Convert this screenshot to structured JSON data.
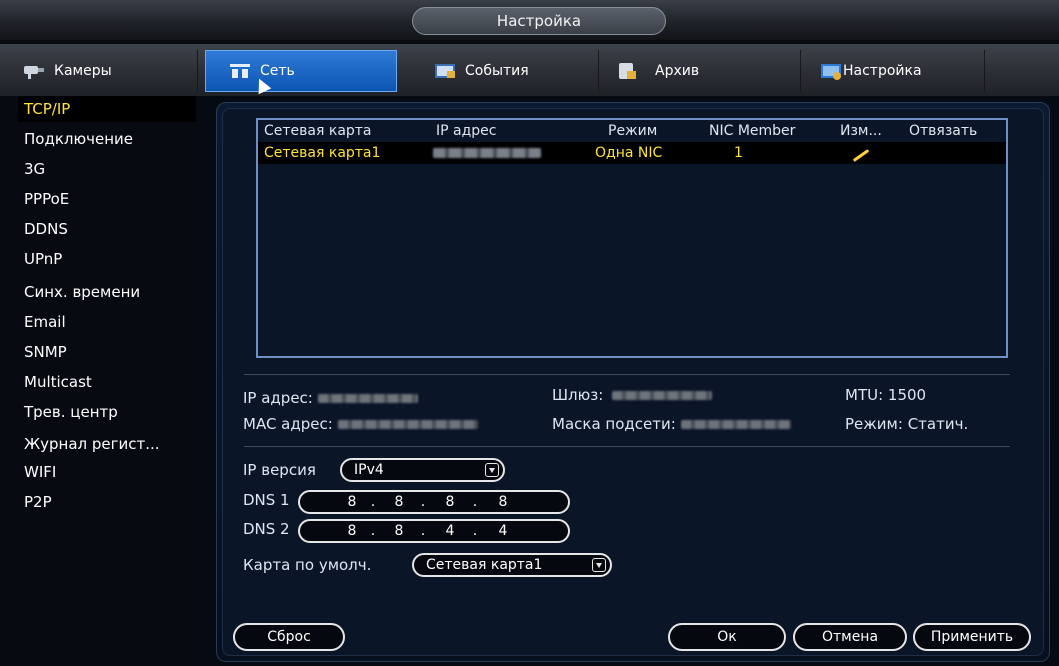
{
  "window": {
    "title": "Настройка"
  },
  "tabs": [
    {
      "label": "Камеры",
      "icon": "cameras-icon"
    },
    {
      "label": "Сеть",
      "icon": "network-icon"
    },
    {
      "label": "События",
      "icon": "events-icon"
    },
    {
      "label": "Архив",
      "icon": "archive-icon"
    },
    {
      "label": "Настройка",
      "icon": "settings-icon"
    }
  ],
  "active_tab": "Сеть",
  "sidebar": {
    "active": "TCP/IP",
    "items": [
      "TCP/IP",
      "Подключение",
      "3G",
      "PPPoE",
      "DDNS",
      "UPnP",
      "Синх. времени",
      "Email",
      "SNMP",
      "Multicast",
      "Трев. центр",
      "Журнал регист...",
      "WIFI",
      "P2P"
    ]
  },
  "nic_table": {
    "headers": {
      "card": "Сетевая карта",
      "ip": "IP адрес",
      "mode": "Режим",
      "member": "NIC Member",
      "edit": "Изм...",
      "unbind": "Отвязать"
    },
    "rows": [
      {
        "card": "Сетевая карта1",
        "ip": "",
        "mode": "Одна NIC",
        "member": "1",
        "edit_icon": "pencil-icon"
      }
    ]
  },
  "info": {
    "ip_label": "IP адрес:",
    "gateway_label": "Шлюз:",
    "mtu_label": "MTU:",
    "mtu_value": "1500",
    "mac_label": "MAC адрес:",
    "mask_label": "Маска подсети:",
    "mode_label": "Режим:",
    "mode_value": "Статич."
  },
  "form": {
    "ip_version_label": "IP версия",
    "ip_version_value": "IPv4",
    "dns1_label": "DNS 1",
    "dns1": [
      "8",
      "8",
      "8",
      "8"
    ],
    "dns2_label": "DNS 2",
    "dns2": [
      "8",
      "8",
      "4",
      "4"
    ],
    "default_card_label": "Карта по умолч.",
    "default_card_value": "Сетевая карта1"
  },
  "buttons": {
    "reset": "Сброс",
    "ok": "Ок",
    "cancel": "Отмена",
    "apply": "Применить"
  },
  "colors": {
    "accent": "#1262c4",
    "selected_text": "#ffe23a",
    "table_border": "#6f90c6"
  }
}
